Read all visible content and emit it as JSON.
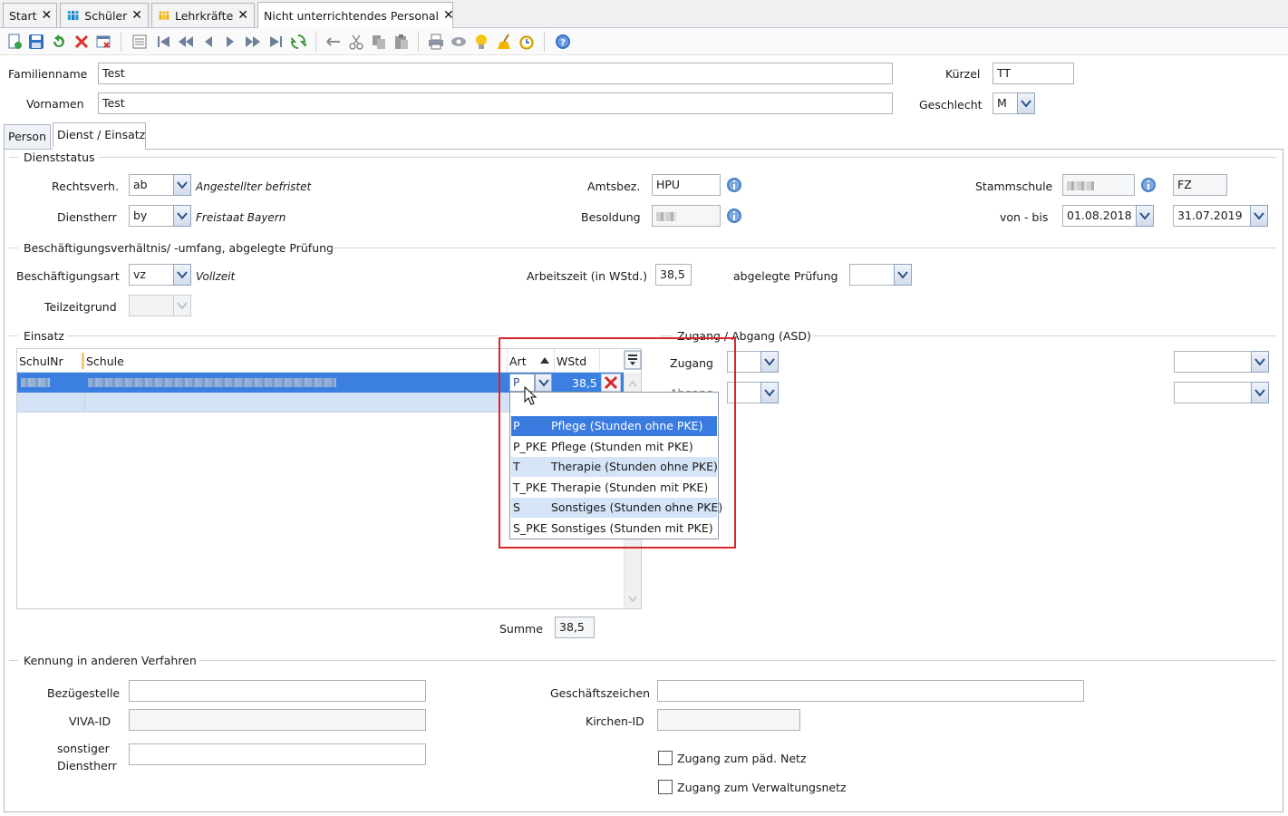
{
  "tabs": [
    {
      "label": "Start",
      "icon": "none"
    },
    {
      "label": "Schüler",
      "icon": "students-icon"
    },
    {
      "label": "Lehrkräfte",
      "icon": "teachers-icon"
    },
    {
      "label": "Nicht unterrichtendes Personal",
      "icon": "none"
    }
  ],
  "header": {
    "familienname_label": "Familienname",
    "familienname_value": "Test",
    "vornamen_label": "Vornamen",
    "vornamen_value": "Test",
    "kuerzel_label": "Kürzel",
    "kuerzel_value": "TT",
    "geschlecht_label": "Geschlecht",
    "geschlecht_value": "M"
  },
  "subtabs": {
    "person": "Person",
    "dienst": "Dienst / Einsatz"
  },
  "dienststatus": {
    "title": "Dienststatus",
    "rechtsverh_label": "Rechtsverh.",
    "rechtsverh_value": "ab",
    "rechtsverh_desc": "Angestellter befristet",
    "dienstherr_label": "Dienstherr",
    "dienstherr_value": "by",
    "dienstherr_desc": "Freistaat Bayern",
    "amtsbez_label": "Amtsbez.",
    "amtsbez_value": "HPU",
    "besoldung_label": "Besoldung",
    "stammschule_label": "Stammschule",
    "stammschule_code": "FZ",
    "vonbis_label": "von - bis",
    "von_value": "01.08.2018",
    "bis_value": "31.07.2019"
  },
  "beschaeftigung": {
    "title": "Beschäftigungsverhältnis/ -umfang, abgelegte Prüfung",
    "art_label": "Beschäftigungsart",
    "art_value": "vz",
    "art_desc": "Vollzeit",
    "arbeitszeit_label": "Arbeitszeit (in WStd.)",
    "arbeitszeit_value": "38,5",
    "pruefung_label": "abgelegte Prüfung",
    "teilzeit_label": "Teilzeitgrund"
  },
  "einsatz": {
    "title": "Einsatz",
    "columns": {
      "schulnr": "SchulNr",
      "schule": "Schule",
      "art": "Art",
      "wstd": "WStd"
    },
    "row_art": "P",
    "row_wstd": "38,5",
    "summe_label": "Summe",
    "summe_value": "38,5"
  },
  "zugang": {
    "title": "Zugang / Abgang (ASD)",
    "zugang_label": "Zugang",
    "abgang_label": "Abgang"
  },
  "art_options": [
    {
      "code": "P",
      "text": "Pflege (Stunden ohne PKE)",
      "state": "selected"
    },
    {
      "code": "P_PKE",
      "text": "Pflege (Stunden mit PKE)",
      "state": "normal"
    },
    {
      "code": "T",
      "text": "Therapie (Stunden ohne PKE)",
      "state": "hover"
    },
    {
      "code": "T_PKE",
      "text": "Therapie (Stunden mit PKE)",
      "state": "normal"
    },
    {
      "code": "S",
      "text": "Sonstiges (Stunden ohne PKE)",
      "state": "hover"
    },
    {
      "code": "S_PKE",
      "text": "Sonstiges (Stunden mit PKE)",
      "state": "normal"
    }
  ],
  "kennung": {
    "title": "Kennung in anderen Verfahren",
    "bezuegestelle_label": "Bezügestelle",
    "vivaid_label": "VIVA-ID",
    "sonstiger_label_1": "sonstiger",
    "sonstiger_label_2": "Dienstherr",
    "geschaeftszeichen_label": "Geschäftszeichen",
    "kirchenid_label": "Kirchen-ID",
    "paednetz_label": "Zugang zum päd. Netz",
    "verwaltungsnetz_label": "Zugang zum Verwaltungsnetz"
  },
  "colors": {
    "selection": "#3b7fe0",
    "highlight": "#d6e4f7",
    "annotation": "#d9262b"
  }
}
